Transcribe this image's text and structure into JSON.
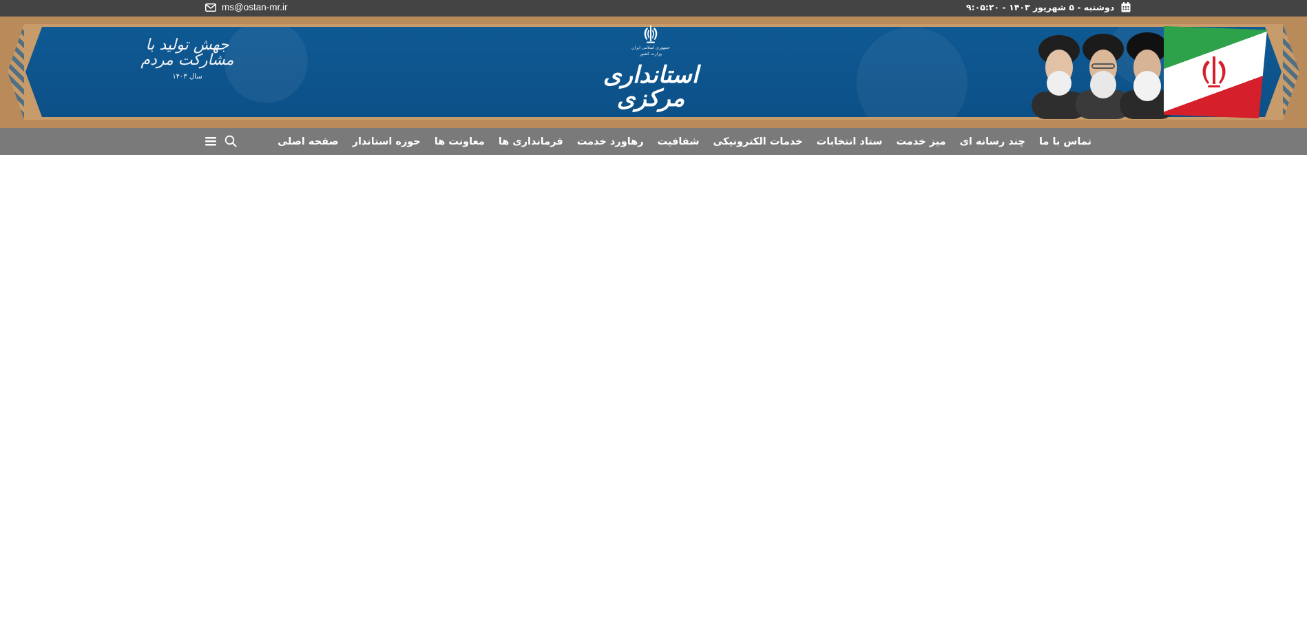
{
  "topbar": {
    "email": "ms@ostan-mr.ir",
    "date": "دوشنبه - ۵ شهریور ۱۴۰۳ - ۹:۰۵:۲۰"
  },
  "banner": {
    "title": "استانداری مرکزی",
    "ministry_line1": "جمهوری اسلامی ایران",
    "ministry_line2": "وزارت کشور",
    "slogan": "جهش تولید با مشارکت مردم",
    "slogan_year": "سال ۱۴۰۳"
  },
  "nav": {
    "items": [
      "صفحه اصلی",
      "حوزه استاندار",
      "معاونت ها",
      "فرمانداری ها",
      "رهاورد خدمت",
      "شفافیت",
      "خدمات الکترونیکی",
      "ستاد انتخابات",
      "میز خدمت",
      "چند رسانه ای",
      "تماس با ما"
    ]
  },
  "icons": {
    "email": "envelope-icon",
    "date": "calendar-icon",
    "search": "search-icon",
    "menu": "hamburger-menu-icon"
  },
  "colors": {
    "topbar": "#444444",
    "navbar": "#7a7a7a",
    "banner_blue": "#0f5a95",
    "banner_gold": "#c89b6a"
  }
}
